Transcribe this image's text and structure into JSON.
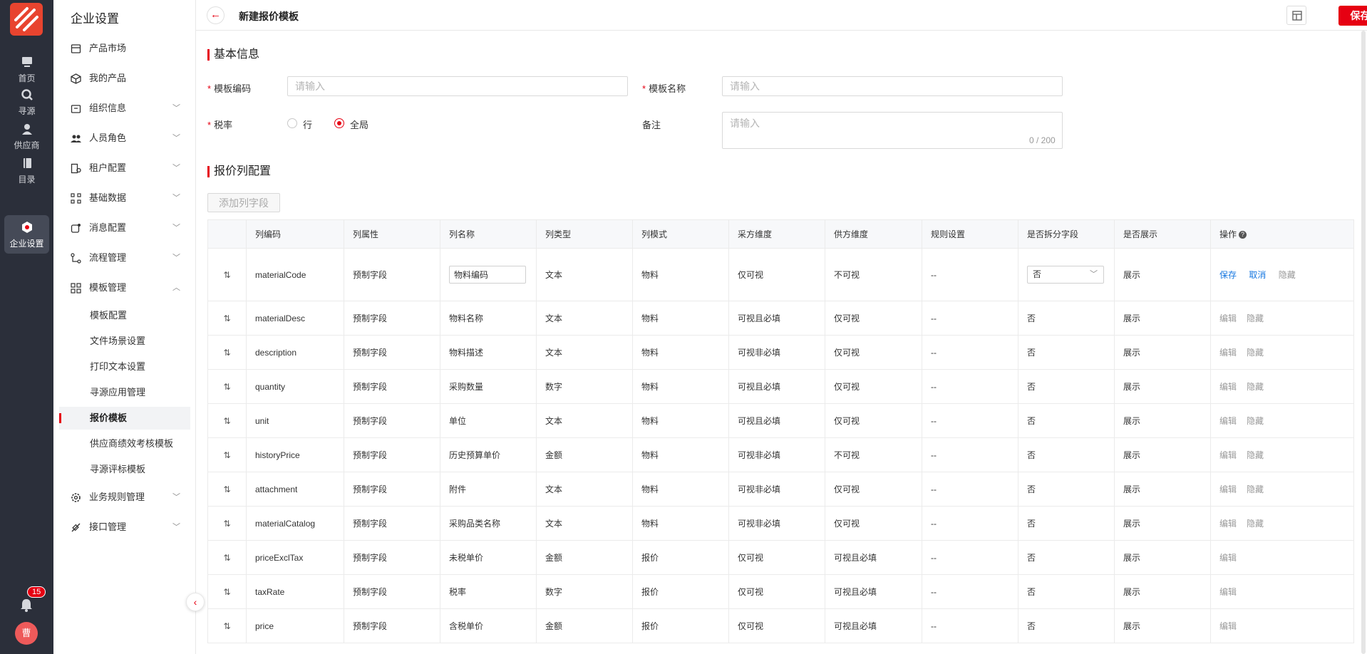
{
  "rail": {
    "items": [
      {
        "label": "首页",
        "icon": "monitor-icon"
      },
      {
        "label": "寻源",
        "icon": "search-icon"
      },
      {
        "label": "供应商",
        "icon": "user-icon"
      },
      {
        "label": "目录",
        "icon": "book-icon"
      },
      {
        "label": "企业设置",
        "icon": "settings-hex-icon"
      }
    ],
    "notification_count": "15",
    "avatar_text": "曹"
  },
  "menu": {
    "title": "企业设置",
    "items": [
      {
        "label": "产品市场",
        "icon": "store-icon"
      },
      {
        "label": "我的产品",
        "icon": "cube-icon"
      },
      {
        "label": "组织信息",
        "icon": "org-icon"
      },
      {
        "label": "人员角色",
        "icon": "users-icon"
      },
      {
        "label": "租户配置",
        "icon": "tenant-icon"
      },
      {
        "label": "基础数据",
        "icon": "data-icon"
      },
      {
        "label": "消息配置",
        "icon": "message-icon"
      },
      {
        "label": "流程管理",
        "icon": "flow-icon"
      },
      {
        "label": "模板管理",
        "icon": "template-icon"
      },
      {
        "label": "业务规则管理",
        "icon": "gear-icon"
      },
      {
        "label": "接口管理",
        "icon": "plug-icon"
      }
    ],
    "sub_items": [
      "模板配置",
      "文件场景设置",
      "打印文本设置",
      "寻源应用管理",
      "报价模板",
      "供应商绩效考核模板",
      "寻源评标模板"
    ]
  },
  "header": {
    "title": "新建报价模板",
    "save_label": "保存"
  },
  "basic": {
    "section_title": "基本信息",
    "code_label": "模板编码",
    "code_placeholder": "请输入",
    "name_label": "模板名称",
    "name_placeholder": "请输入",
    "tax_label": "税率",
    "tax_options": [
      "行",
      "全局"
    ],
    "tax_selected": "全局",
    "remark_label": "备注",
    "remark_placeholder": "请输入",
    "remark_counter": "0 / 200"
  },
  "columns": {
    "section_title": "报价列配置",
    "add_label": "添加列字段",
    "headers": [
      "列编码",
      "列属性",
      "列名称",
      "列类型",
      "列模式",
      "采方维度",
      "供方维度",
      "规则设置",
      "是否拆分字段",
      "是否展示",
      "操作"
    ],
    "editing_row": {
      "code": "materialCode",
      "attr": "预制字段",
      "name_input": "物料编码",
      "type": "文本",
      "mode": "物料",
      "buyer": "仅可视",
      "supplier": "不可视",
      "rule": "--",
      "split_select": "否",
      "show": "展示",
      "ops": [
        "保存",
        "取消",
        "隐藏"
      ]
    },
    "rows": [
      {
        "code": "materialDesc",
        "attr": "预制字段",
        "name": "物料名称",
        "type": "文本",
        "mode": "物料",
        "buyer": "可视且必填",
        "supplier": "仅可视",
        "rule": "--",
        "split": "否",
        "show": "展示",
        "op1": "编辑",
        "op2": "隐藏"
      },
      {
        "code": "description",
        "attr": "预制字段",
        "name": "物料描述",
        "type": "文本",
        "mode": "物料",
        "buyer": "可视非必填",
        "supplier": "仅可视",
        "rule": "--",
        "split": "否",
        "show": "展示",
        "op1": "编辑",
        "op2": "隐藏"
      },
      {
        "code": "quantity",
        "attr": "预制字段",
        "name": "采购数量",
        "type": "数字",
        "mode": "物料",
        "buyer": "可视且必填",
        "supplier": "仅可视",
        "rule": "--",
        "split": "否",
        "show": "展示",
        "op1": "编辑",
        "op2": "隐藏"
      },
      {
        "code": "unit",
        "attr": "预制字段",
        "name": "单位",
        "type": "文本",
        "mode": "物料",
        "buyer": "可视且必填",
        "supplier": "仅可视",
        "rule": "--",
        "split": "否",
        "show": "展示",
        "op1": "编辑",
        "op2": "隐藏"
      },
      {
        "code": "historyPrice",
        "attr": "预制字段",
        "name": "历史预算单价",
        "type": "金额",
        "mode": "物料",
        "buyer": "可视非必填",
        "supplier": "不可视",
        "rule": "--",
        "split": "否",
        "show": "展示",
        "op1": "编辑",
        "op2": "隐藏"
      },
      {
        "code": "attachment",
        "attr": "预制字段",
        "name": "附件",
        "type": "文本",
        "mode": "物料",
        "buyer": "可视非必填",
        "supplier": "仅可视",
        "rule": "--",
        "split": "否",
        "show": "展示",
        "op1": "编辑",
        "op2": "隐藏"
      },
      {
        "code": "materialCatalog",
        "attr": "预制字段",
        "name": "采购品类名称",
        "type": "文本",
        "mode": "物料",
        "buyer": "可视非必填",
        "supplier": "仅可视",
        "rule": "--",
        "split": "否",
        "show": "展示",
        "op1": "编辑",
        "op2": "隐藏"
      },
      {
        "code": "priceExclTax",
        "attr": "预制字段",
        "name": "未税单价",
        "type": "金额",
        "mode": "报价",
        "buyer": "仅可视",
        "supplier": "可视且必填",
        "rule": "--",
        "split": "否",
        "show": "展示",
        "op1": "编辑",
        "op2": ""
      },
      {
        "code": "taxRate",
        "attr": "预制字段",
        "name": "税率",
        "type": "数字",
        "mode": "报价",
        "buyer": "仅可视",
        "supplier": "可视且必填",
        "rule": "--",
        "split": "否",
        "show": "展示",
        "op1": "编辑",
        "op2": ""
      },
      {
        "code": "price",
        "attr": "预制字段",
        "name": "含税单价",
        "type": "金额",
        "mode": "报价",
        "buyer": "仅可视",
        "supplier": "可视且必填",
        "rule": "--",
        "split": "否",
        "show": "展示",
        "op1": "编辑",
        "op2": ""
      }
    ]
  },
  "colors": {
    "accent": "#e60012",
    "rail_bg": "#2b2f3a",
    "link": "#1677e0"
  }
}
